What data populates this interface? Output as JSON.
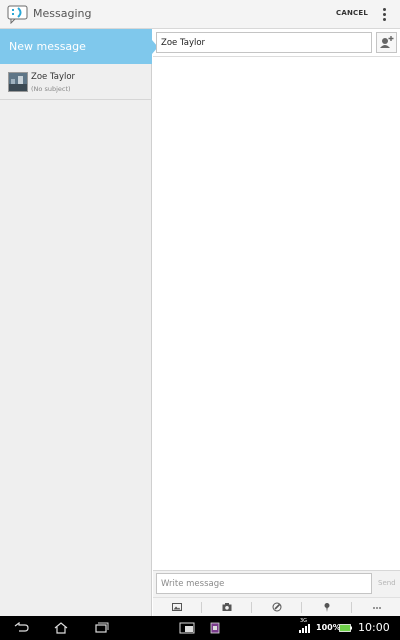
{
  "action_bar": {
    "app_title": "Messaging",
    "app_icon": "messaging-icon",
    "cancel_label": "CANCEL",
    "overflow_icon": "overflow-menu-icon"
  },
  "sidebar": {
    "new_message_label": "New message",
    "threads": [
      {
        "name": "Zoe Taylor",
        "subject": "(No subject)"
      }
    ]
  },
  "compose": {
    "recipient_value": "Zoe Taylor",
    "message_placeholder": "Write message",
    "send_label": "Send",
    "attachments": [
      "gallery-icon",
      "camera-icon",
      "sketch-icon",
      "location-icon",
      "more-icon"
    ]
  },
  "status_bar": {
    "network": "3G",
    "battery_percent": "100%",
    "time": "10:00"
  },
  "colors": {
    "accent": "#7fc8ec",
    "battery": "#6fd14a",
    "navbar": "#000000"
  }
}
